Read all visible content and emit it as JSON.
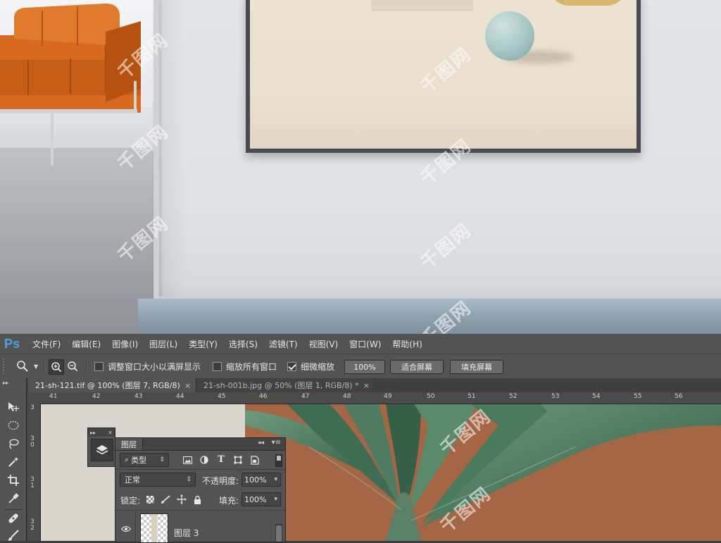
{
  "app": {
    "logo": "Ps",
    "menu": [
      "文件(F)",
      "编辑(E)",
      "图像(I)",
      "图层(L)",
      "类型(Y)",
      "选择(S)",
      "滤镜(T)",
      "视图(V)",
      "窗口(W)",
      "帮助(H)"
    ]
  },
  "options": {
    "resize_windows_label": "调整窗口大小以满屏显示",
    "resize_windows_checked": false,
    "zoom_all_label": "缩放所有窗口",
    "zoom_all_checked": false,
    "scrubby_label": "细微缩放",
    "scrubby_checked": true,
    "zoom_value": "100%",
    "fit_screen": "适合屏幕",
    "fill_screen": "填充屏幕"
  },
  "tabs": [
    {
      "label": "21-sh-121.tif @ 100% (图层 7, RGB/8)",
      "close": "×",
      "active": true
    },
    {
      "label": "21-sh-001b.jpg @ 50% (图层 1, RGB/8) *",
      "close": "×",
      "active": false
    }
  ],
  "ruler": {
    "h": [
      "41",
      "42",
      "43",
      "44",
      "45",
      "46",
      "47",
      "48",
      "49",
      "50",
      "51",
      "52",
      "53",
      "54",
      "55",
      "56"
    ],
    "v": [
      "3",
      "3\n0",
      "3\n1",
      "3\n2"
    ]
  },
  "layers_panel": {
    "title": "图层",
    "filter_label": "类型",
    "blend_mode": "正常",
    "opacity_label": "不透明度:",
    "opacity_value": "100%",
    "lock_label": "锁定:",
    "fill_label": "填充:",
    "fill_value": "100%",
    "layers": [
      {
        "name": "图层 3",
        "visible": true
      }
    ]
  },
  "watermark": "千图网",
  "colors": {
    "ps_blue": "#4aa3e0",
    "panel_bg": "#535353",
    "canvas_rust": "#a46645",
    "sofa_orange": "#d86a1f"
  }
}
